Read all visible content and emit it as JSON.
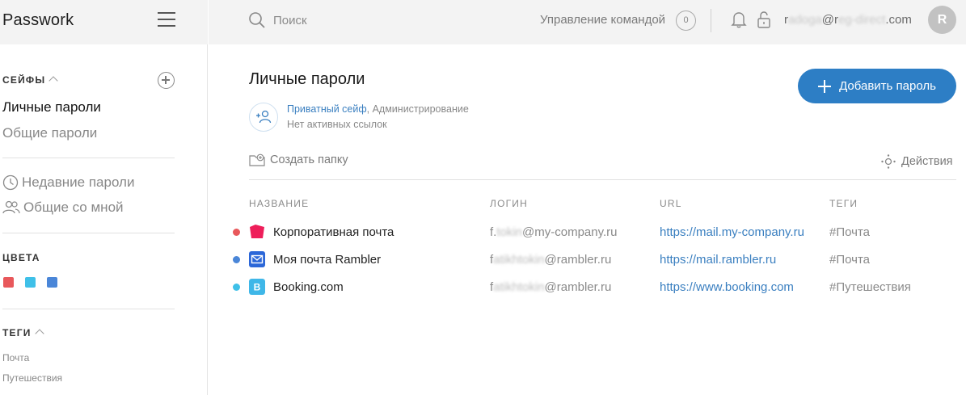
{
  "app": {
    "name": "Passwork"
  },
  "sidebar": {
    "vaults_title": "СЕЙФЫ",
    "vaults": [
      {
        "label": "Личные пароли",
        "active": true
      },
      {
        "label": "Общие пароли",
        "active": false
      }
    ],
    "recent_label": "Недавние пароли",
    "shared_label": "Общие со мной",
    "colors_title": "ЦВЕТА",
    "colors": [
      "#e8585b",
      "#3fc0e8",
      "#4a86d8"
    ],
    "tags_title": "ТЕГИ",
    "tags": [
      "Почта",
      "Путешествия"
    ]
  },
  "topbar": {
    "search_placeholder": "Поиск",
    "team_label": "Управление командой",
    "team_count": "0",
    "email_visible_start": "r",
    "email_blur_1": "adoga",
    "email_visible_mid": "@r",
    "email_blur_2": "eg-direct",
    "email_visible_end": ".com",
    "avatar_letter": "R"
  },
  "main": {
    "title": "Личные пароли",
    "add_button": "Добавить пароль",
    "vault_type": "Приватный сейф",
    "vault_role": ", Администрирование",
    "vault_links": "Нет активных ссылок",
    "create_folder": "Создать папку",
    "actions": "Действия",
    "columns": {
      "name": "НАЗВАНИЕ",
      "login": "ЛОГИН",
      "url": "URL",
      "tags": "ТЕГИ"
    },
    "rows": [
      {
        "color": "#e8585b",
        "icon": "red-folder-icon",
        "icon_color": "#ee1e5a",
        "name": "Корпоративная почта",
        "login_visible": "f.",
        "login_blur": "tokin",
        "login_end": "@my-company.ru",
        "url": "https://mail.my-company.ru",
        "tag": "#Почта"
      },
      {
        "color": "#4a86d8",
        "icon": "mail-envelope-icon",
        "icon_color": "#2c67d8",
        "name": "Моя почта Rambler",
        "login_visible": "f",
        "login_blur": "atikhtokin",
        "login_end": "@rambler.ru",
        "url": "https://mail.rambler.ru",
        "tag": "#Почта"
      },
      {
        "color": "#3fc0e8",
        "icon": "booking-b-icon",
        "icon_color": "#3fb7e8",
        "icon_letter": "B",
        "name": "Booking.com",
        "login_visible": "f",
        "login_blur": "atikhtokin",
        "login_end": "@rambler.ru",
        "url": "https://www.booking.com",
        "tag": "#Путешествия"
      }
    ]
  }
}
